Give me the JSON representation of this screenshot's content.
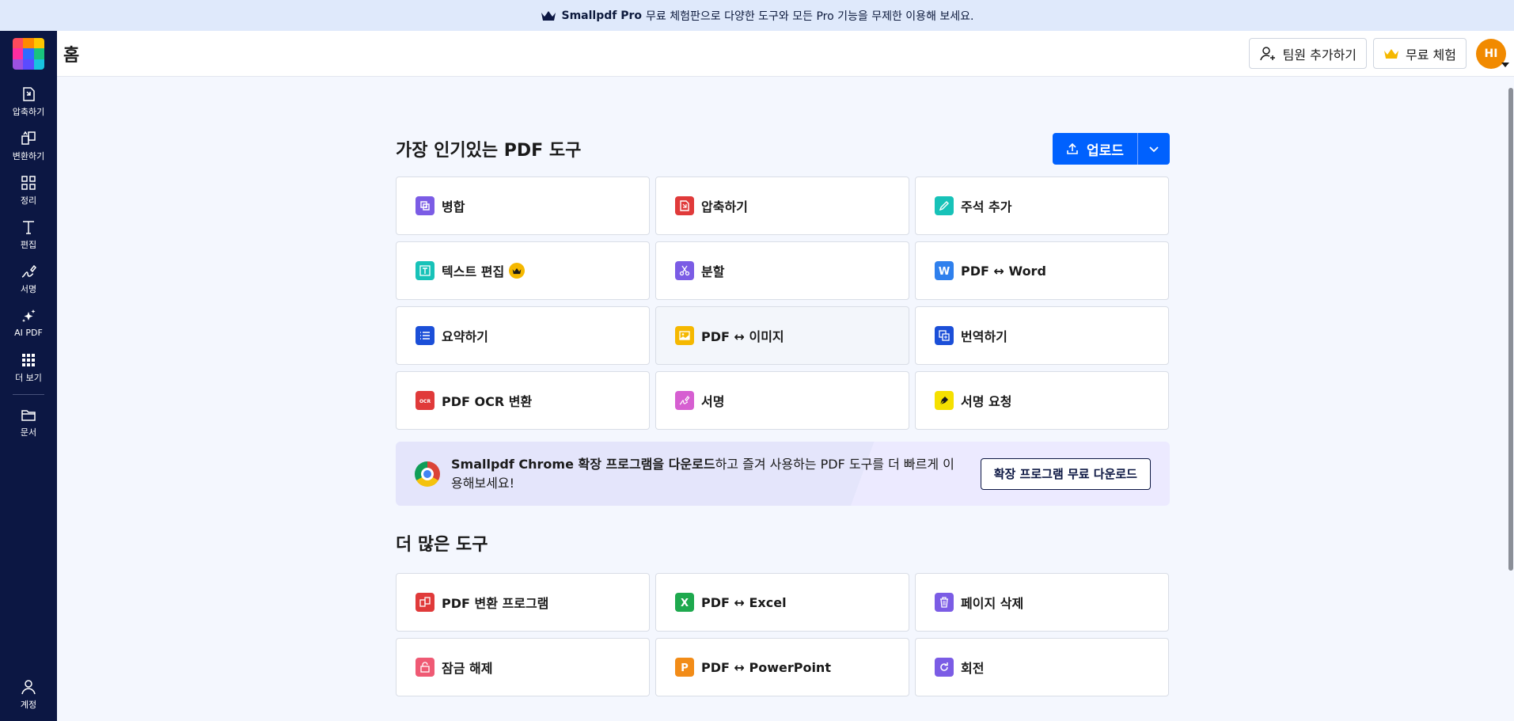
{
  "promo": {
    "brand": "Smallpdf Pro",
    "text": "무료 체험판으로 다양한 도구와 모든 Pro 기능을 무제한 이용해 보세요."
  },
  "header": {
    "title": "홈",
    "team_button": "팀원 추가하기",
    "trial_button": "무료 체험",
    "avatar_initials": "HI"
  },
  "sidebar": {
    "items": [
      {
        "label": "압축하기",
        "icon": "compress-icon"
      },
      {
        "label": "변환하기",
        "icon": "convert-icon"
      },
      {
        "label": "정리",
        "icon": "organize-icon"
      },
      {
        "label": "편집",
        "icon": "edit-text-icon"
      },
      {
        "label": "서명",
        "icon": "sign-icon"
      },
      {
        "label": "AI PDF",
        "icon": "ai-sparkle-icon"
      },
      {
        "label": "더 보기",
        "icon": "grid-icon"
      },
      {
        "label": "문서",
        "icon": "folder-icon"
      }
    ],
    "account_label": "계정"
  },
  "popular": {
    "title": "가장 인기있는 PDF 도구",
    "upload_label": "업로드",
    "tools": [
      {
        "label": "병합",
        "icon": "merge-icon",
        "color": "#7b5ce5"
      },
      {
        "label": "압축하기",
        "icon": "compress-icon",
        "color": "#e03a3a"
      },
      {
        "label": "주석 추가",
        "icon": "annotate-icon",
        "color": "#17c2b8"
      },
      {
        "label": "텍스트 편집",
        "icon": "text-edit-icon",
        "color": "#17c2b8",
        "pro": true
      },
      {
        "label": "분할",
        "icon": "split-icon",
        "color": "#7b5ce5"
      },
      {
        "label": "PDF ↔ Word",
        "icon": "word-icon",
        "color": "#2f80ed"
      },
      {
        "label": "요약하기",
        "icon": "summary-icon",
        "color": "#1b4fd8"
      },
      {
        "label": "PDF ↔ 이미지",
        "icon": "image-icon",
        "color": "#f5b800"
      },
      {
        "label": "번역하기",
        "icon": "translate-icon",
        "color": "#1b4fd8"
      },
      {
        "label": "PDF OCR 변환",
        "icon": "ocr-icon",
        "color": "#e03a3a"
      },
      {
        "label": "서명",
        "icon": "sign-icon",
        "color": "#d65fd1"
      },
      {
        "label": "서명 요청",
        "icon": "request-sign-icon",
        "color": "#f5e000"
      }
    ]
  },
  "chrome_banner": {
    "bold_text": "Smallpdf Chrome 확장 프로그램을 다운로드",
    "text": "하고 즐겨 사용하는 PDF 도구를 더 빠르게 이용해보세요!",
    "button": "확장 프로그램 무료 다운로드"
  },
  "more": {
    "title": "더 많은 도구",
    "tools": [
      {
        "label": "PDF 변환 프로그램",
        "icon": "convert-icon",
        "color": "#e03a3a"
      },
      {
        "label": "PDF ↔ Excel",
        "icon": "excel-icon",
        "color": "#1ea94e"
      },
      {
        "label": "페이지 삭제",
        "icon": "trash-icon",
        "color": "#7b5ce5"
      },
      {
        "label": "잠금 해제",
        "icon": "unlock-icon",
        "color": "#ef5a74"
      },
      {
        "label": "PDF ↔ PowerPoint",
        "icon": "powerpoint-icon",
        "color": "#f28c18"
      },
      {
        "label": "회전",
        "icon": "rotate-icon",
        "color": "#7b5ce5"
      }
    ]
  }
}
